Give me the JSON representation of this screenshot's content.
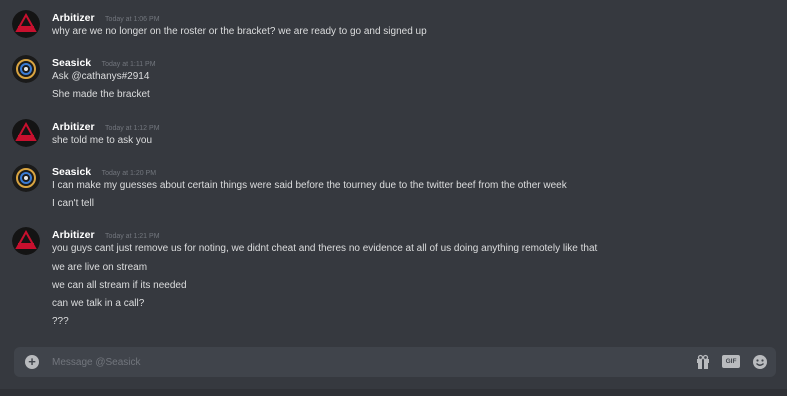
{
  "messages": [
    {
      "author": "Arbitizer",
      "timestamp": "Today at 1:06 PM",
      "avatar": "arbitizer-avatar",
      "lines": [
        "why are we no longer on the roster or the bracket? we are ready to go and signed up"
      ]
    },
    {
      "author": "Seasick",
      "timestamp": "Today at 1:11 PM",
      "avatar": "seasick-avatar",
      "lines": [
        "Ask @cathanys#2914",
        "She made the bracket"
      ]
    },
    {
      "author": "Arbitizer",
      "timestamp": "Today at 1:12 PM",
      "avatar": "arbitizer-avatar",
      "lines": [
        "she told me to ask you"
      ]
    },
    {
      "author": "Seasick",
      "timestamp": "Today at 1:20 PM",
      "avatar": "seasick-avatar",
      "lines": [
        "I can make my guesses about certain things were said before the tourney due to the twitter beef from the other week",
        "I can't tell"
      ]
    },
    {
      "author": "Arbitizer",
      "timestamp": "Today at 1:21 PM",
      "avatar": "arbitizer-avatar",
      "lines": [
        "you guys cant just remove us for noting, we didnt cheat and theres no evidence at all of us doing anything remotely like that",
        "we are live on stream",
        "we can all stream if its needed",
        "can we talk in a call?",
        "???"
      ]
    }
  ],
  "composer": {
    "placeholder": "Message @Seasick",
    "value": "",
    "upload_icon": "plus-circle-icon",
    "gift_icon": "gift-icon",
    "gif_label": "GIF",
    "emoji_icon": "smiley-emoji-icon"
  },
  "colors": {
    "background": "#36393f",
    "composer": "#40444b",
    "author": "#ffffff",
    "text": "#dcddde",
    "timestamp": "#72767d",
    "arbitizer_avatar": "#c8102e",
    "seasick_avatar": "#1a1a1a"
  }
}
